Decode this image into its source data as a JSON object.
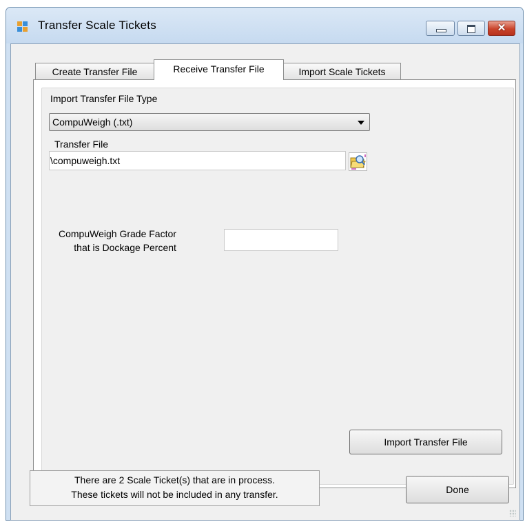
{
  "window": {
    "title": "Transfer Scale Tickets",
    "icon": "app-form-icon",
    "controls": [
      "minimize-icon",
      "maximize-icon",
      "close-icon"
    ]
  },
  "tabs": [
    {
      "label": "Create Transfer File",
      "active": false
    },
    {
      "label": "Receive Transfer File",
      "active": true
    },
    {
      "label": "Import Scale Tickets",
      "active": false
    }
  ],
  "receive": {
    "type_label": "Import Transfer File Type",
    "type_value": "CompuWeigh (.txt)",
    "file_label": "Transfer File",
    "file_value": "\\compuweigh.txt",
    "browse_icon": "browse-folder-icon",
    "grade_label_line1": "CompuWeigh Grade Factor",
    "grade_label_line2": "that is Dockage Percent",
    "grade_value": "",
    "import_button": "Import Transfer File"
  },
  "footer": {
    "status_line1": "There are 2 Scale Ticket(s) that are in process.",
    "status_line2": "These tickets will not be included in any transfer.",
    "done_button": "Done"
  },
  "colors": {
    "title_bar": "#cfe0f2",
    "close_button": "#c9442b",
    "form_background": "#f0f0f0"
  }
}
